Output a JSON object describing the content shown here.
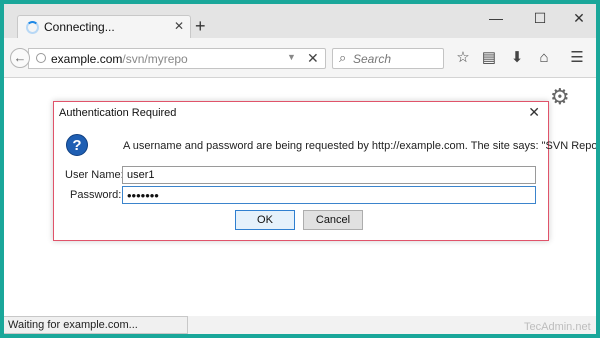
{
  "tab": {
    "title": "Connecting...",
    "close": "✕",
    "new_tab": "+"
  },
  "window_controls": {
    "minimize": "—",
    "maximize": "☐",
    "close": "✕"
  },
  "navbar": {
    "url_host": "example.com",
    "url_path": "/svn/myrepo",
    "dropdown": "▼",
    "clear": "✕",
    "search_placeholder": "Search"
  },
  "toolbar_icons": [
    "star-icon",
    "reading-list-icon",
    "download-icon",
    "home-icon",
    "menu-icon"
  ],
  "dialog": {
    "title": "Authentication Required",
    "close": "✕",
    "icon_glyph": "?",
    "message": "A username and password are being requested by http://example.com. The site says: \"SVN Repo\"",
    "username_label": "User Name:",
    "username_value": "user1",
    "password_label": "Password:",
    "password_value": "1234567",
    "ok_label": "OK",
    "cancel_label": "Cancel"
  },
  "status_bar": {
    "text": "Waiting for example.com..."
  },
  "watermark": "TecAdmin.net",
  "colors": {
    "desktop": "#1aa79a",
    "dialog_border": "#e0536a",
    "focus": "#3b84cc",
    "question_icon": "#1f5fb3"
  }
}
